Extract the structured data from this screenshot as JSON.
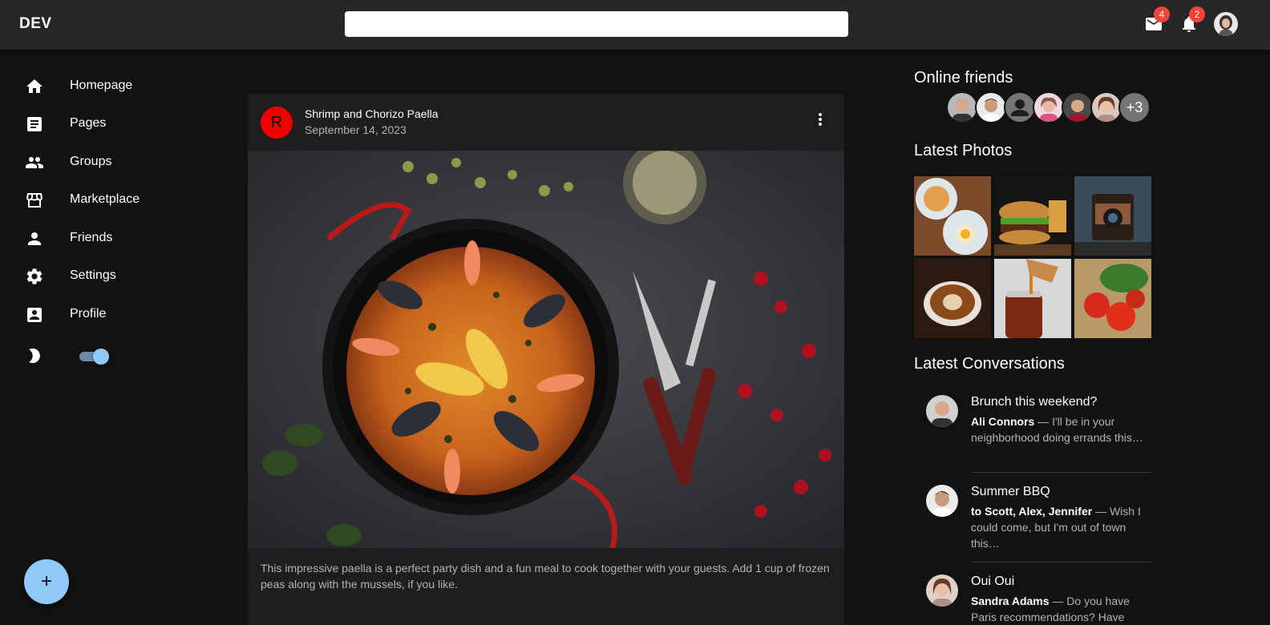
{
  "app": {
    "title": "DEV"
  },
  "search": {
    "placeholder": ""
  },
  "header": {
    "mail_badge": "4",
    "notifications_badge": "2"
  },
  "sidebar": {
    "items": [
      {
        "label": "Homepage",
        "icon": "home-icon"
      },
      {
        "label": "Pages",
        "icon": "article-icon"
      },
      {
        "label": "Groups",
        "icon": "groups-icon"
      },
      {
        "label": "Marketplace",
        "icon": "storefront-icon"
      },
      {
        "label": "Friends",
        "icon": "person-icon"
      },
      {
        "label": "Settings",
        "icon": "gear-icon"
      },
      {
        "label": "Profile",
        "icon": "account-box-icon"
      }
    ],
    "dark_mode": true
  },
  "fab": {
    "label": "+"
  },
  "post": {
    "avatar_letter": "R",
    "title": "Shrimp and Chorizo Paella",
    "date": "September 14, 2023",
    "text": "This impressive paella is a perfect party dish and a fun meal to cook together with your guests. Add 1 cup of frozen peas along with the mussels, if you like."
  },
  "online_friends": {
    "heading": "Online friends",
    "more_label": "+3"
  },
  "latest_photos": {
    "heading": "Latest Photos"
  },
  "conversations": {
    "heading": "Latest Conversations",
    "items": [
      {
        "title": "Brunch this weekend?",
        "from": "Ali Connors",
        "snippet": " — I'll be in your neighborhood doing errands this…"
      },
      {
        "title": "Summer BBQ",
        "from": "to Scott, Alex, Jennifer",
        "snippet": " — Wish I could come, but I'm out of town this…"
      },
      {
        "title": "Oui Oui",
        "from": "Sandra Adams",
        "snippet": " — Do you have Paris recommendations? Have you ever…"
      }
    ]
  },
  "colors": {
    "background": "#121212",
    "topbar": "#272727",
    "card": "#1e1e1e",
    "accent": "#90caf9",
    "badge": "#f44336",
    "post_avatar": "#f00000"
  }
}
